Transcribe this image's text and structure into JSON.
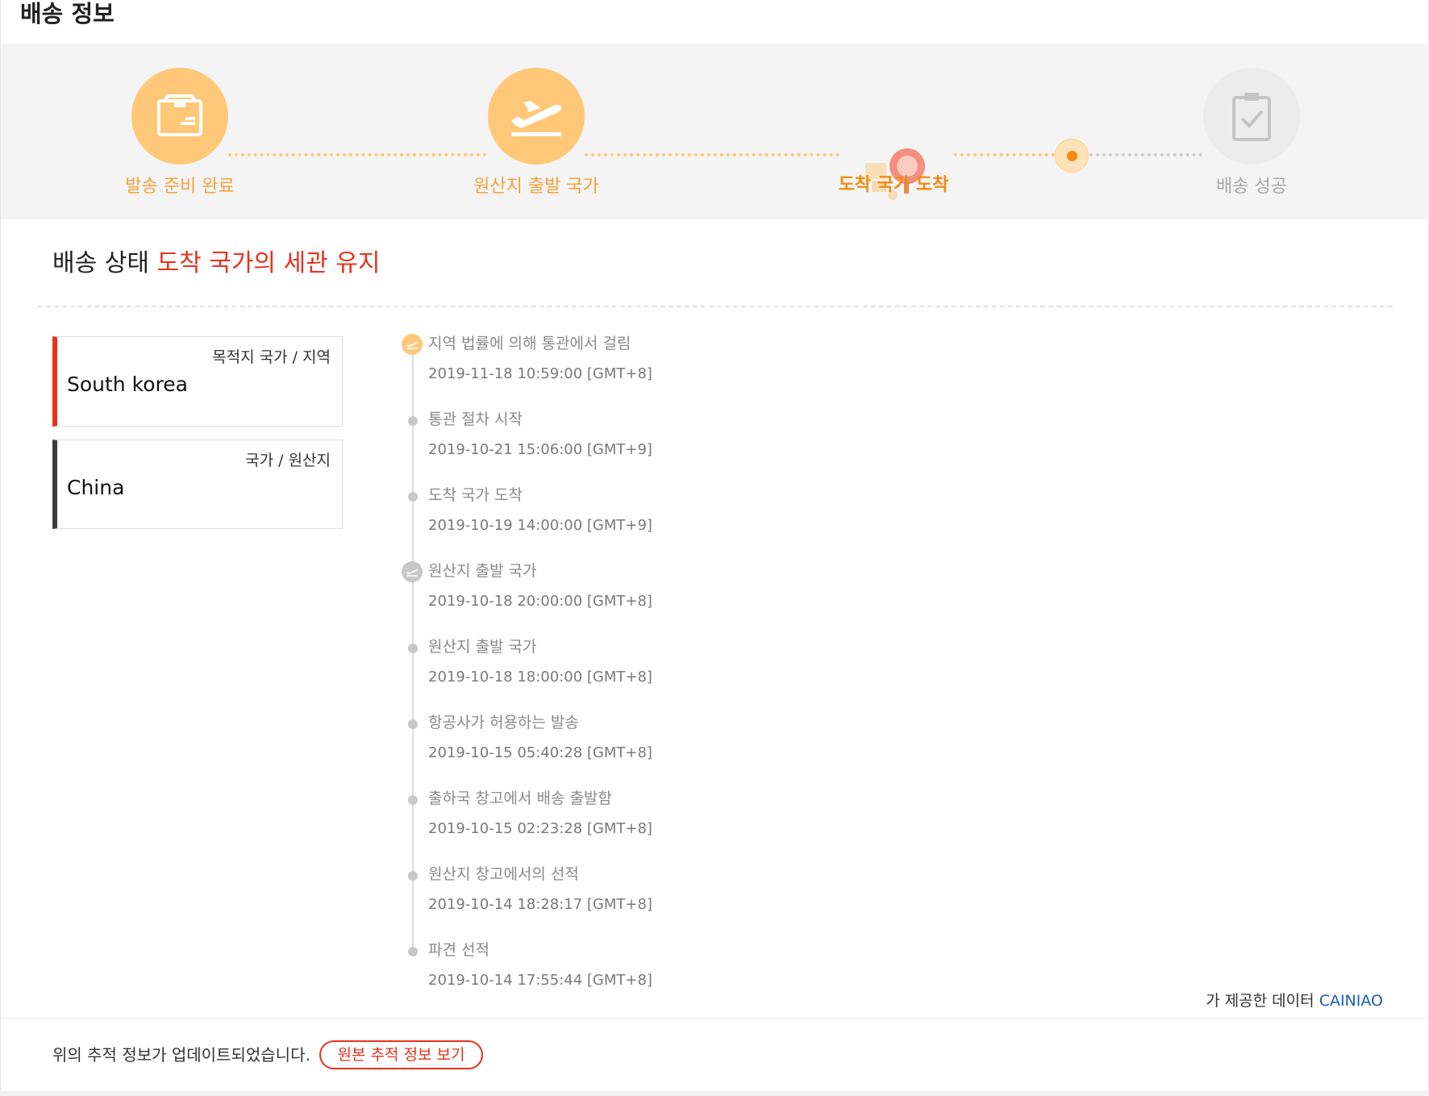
{
  "header": {
    "title": "배송 정보"
  },
  "steps": [
    {
      "label": "발송 준비 완료",
      "state": "done",
      "icon": "box-icon"
    },
    {
      "label": "원산지 출발 국가",
      "state": "done",
      "icon": "plane-departure-icon"
    },
    {
      "label": "도착 국가 도착",
      "state": "current",
      "icon": "customs-parcel-icon"
    },
    {
      "label": "배송 성공",
      "state": "todo",
      "icon": "clipboard-check-icon"
    }
  ],
  "status": {
    "prefix": "배송 상태",
    "value": "도착 국가의 세관 유지"
  },
  "destination": {
    "caption": "목적지 국가 / 지역",
    "name": "South korea"
  },
  "origin": {
    "caption": "국가 / 원산지",
    "name": "China"
  },
  "timeline": [
    {
      "text": "지역 법률에 의해 통관에서 걸림",
      "time": "2019-11-18 10:59:00 [GMT+8]",
      "marker": "plane-orange"
    },
    {
      "text": "통관 절차 시작",
      "time": "2019-10-21 15:06:00 [GMT+9]",
      "marker": "dot"
    },
    {
      "text": "도착 국가 도착",
      "time": "2019-10-19 14:00:00 [GMT+9]",
      "marker": "dot"
    },
    {
      "text": "원산지 출발 국가",
      "time": "2019-10-18 20:00:00 [GMT+8]",
      "marker": "plane-gray"
    },
    {
      "text": "원산지 출발 국가",
      "time": "2019-10-18 18:00:00 [GMT+8]",
      "marker": "dot"
    },
    {
      "text": "항공사가 허용하는 발송",
      "time": "2019-10-15 05:40:28 [GMT+8]",
      "marker": "dot"
    },
    {
      "text": "출하국 창고에서 배송 출발함",
      "time": "2019-10-15 02:23:28 [GMT+8]",
      "marker": "dot"
    },
    {
      "text": "원산지 창고에서의 선적",
      "time": "2019-10-14 18:28:17 [GMT+8]",
      "marker": "dot"
    },
    {
      "text": "파견 선적",
      "time": "2019-10-14 17:55:44 [GMT+8]",
      "marker": "dot"
    }
  ],
  "provider": {
    "prefix": "가 제공한 데이터",
    "name": "CAINIAO"
  },
  "footer": {
    "note": "위의 추적 정보가 업데이트되었습니다.",
    "button": "원본 추적 정보 보기"
  },
  "colors": {
    "accent": "#f5a13c",
    "accent_light": "#ffc878",
    "highlight": "#e8321c",
    "link": "#1a5fb4"
  }
}
